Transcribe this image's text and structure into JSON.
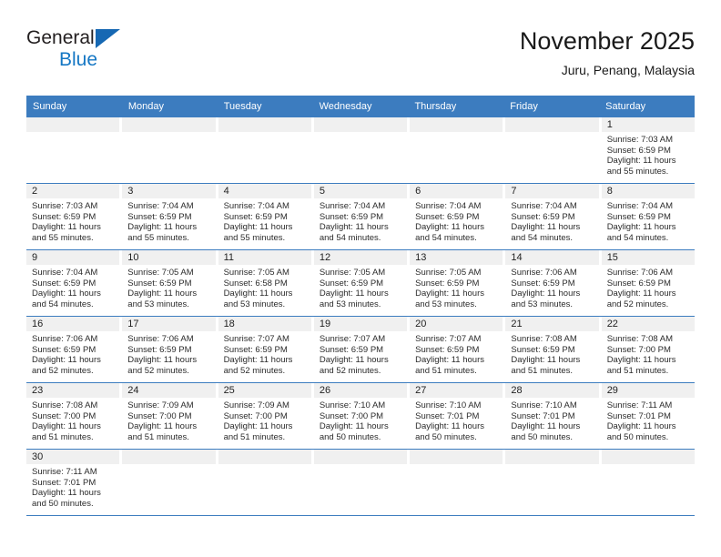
{
  "brand": {
    "name_top": "General",
    "name_bottom": "Blue",
    "flag_icon": "triangle-flag-icon",
    "color_black": "#231f20",
    "color_blue": "#1577c4"
  },
  "header": {
    "title": "November 2025",
    "subtitle": "Juru, Penang, Malaysia"
  },
  "theme": {
    "header_bar": "#3c7cbf",
    "day_band": "#f0f0f0",
    "row_divider": "#3c7cbf",
    "text": "#222222"
  },
  "calendar": {
    "weekdays": [
      "Sunday",
      "Monday",
      "Tuesday",
      "Wednesday",
      "Thursday",
      "Friday",
      "Saturday"
    ],
    "labels": {
      "sunrise": "Sunrise:",
      "sunset": "Sunset:",
      "daylight": "Daylight:"
    },
    "weeks": [
      [
        {
          "day": "",
          "lines": []
        },
        {
          "day": "",
          "lines": []
        },
        {
          "day": "",
          "lines": []
        },
        {
          "day": "",
          "lines": []
        },
        {
          "day": "",
          "lines": []
        },
        {
          "day": "",
          "lines": []
        },
        {
          "day": "1",
          "lines": [
            "Sunrise: 7:03 AM",
            "Sunset: 6:59 PM",
            "Daylight: 11 hours",
            "and 55 minutes."
          ]
        }
      ],
      [
        {
          "day": "2",
          "lines": [
            "Sunrise: 7:03 AM",
            "Sunset: 6:59 PM",
            "Daylight: 11 hours",
            "and 55 minutes."
          ]
        },
        {
          "day": "3",
          "lines": [
            "Sunrise: 7:04 AM",
            "Sunset: 6:59 PM",
            "Daylight: 11 hours",
            "and 55 minutes."
          ]
        },
        {
          "day": "4",
          "lines": [
            "Sunrise: 7:04 AM",
            "Sunset: 6:59 PM",
            "Daylight: 11 hours",
            "and 55 minutes."
          ]
        },
        {
          "day": "5",
          "lines": [
            "Sunrise: 7:04 AM",
            "Sunset: 6:59 PM",
            "Daylight: 11 hours",
            "and 54 minutes."
          ]
        },
        {
          "day": "6",
          "lines": [
            "Sunrise: 7:04 AM",
            "Sunset: 6:59 PM",
            "Daylight: 11 hours",
            "and 54 minutes."
          ]
        },
        {
          "day": "7",
          "lines": [
            "Sunrise: 7:04 AM",
            "Sunset: 6:59 PM",
            "Daylight: 11 hours",
            "and 54 minutes."
          ]
        },
        {
          "day": "8",
          "lines": [
            "Sunrise: 7:04 AM",
            "Sunset: 6:59 PM",
            "Daylight: 11 hours",
            "and 54 minutes."
          ]
        }
      ],
      [
        {
          "day": "9",
          "lines": [
            "Sunrise: 7:04 AM",
            "Sunset: 6:59 PM",
            "Daylight: 11 hours",
            "and 54 minutes."
          ]
        },
        {
          "day": "10",
          "lines": [
            "Sunrise: 7:05 AM",
            "Sunset: 6:59 PM",
            "Daylight: 11 hours",
            "and 53 minutes."
          ]
        },
        {
          "day": "11",
          "lines": [
            "Sunrise: 7:05 AM",
            "Sunset: 6:58 PM",
            "Daylight: 11 hours",
            "and 53 minutes."
          ]
        },
        {
          "day": "12",
          "lines": [
            "Sunrise: 7:05 AM",
            "Sunset: 6:59 PM",
            "Daylight: 11 hours",
            "and 53 minutes."
          ]
        },
        {
          "day": "13",
          "lines": [
            "Sunrise: 7:05 AM",
            "Sunset: 6:59 PM",
            "Daylight: 11 hours",
            "and 53 minutes."
          ]
        },
        {
          "day": "14",
          "lines": [
            "Sunrise: 7:06 AM",
            "Sunset: 6:59 PM",
            "Daylight: 11 hours",
            "and 53 minutes."
          ]
        },
        {
          "day": "15",
          "lines": [
            "Sunrise: 7:06 AM",
            "Sunset: 6:59 PM",
            "Daylight: 11 hours",
            "and 52 minutes."
          ]
        }
      ],
      [
        {
          "day": "16",
          "lines": [
            "Sunrise: 7:06 AM",
            "Sunset: 6:59 PM",
            "Daylight: 11 hours",
            "and 52 minutes."
          ]
        },
        {
          "day": "17",
          "lines": [
            "Sunrise: 7:06 AM",
            "Sunset: 6:59 PM",
            "Daylight: 11 hours",
            "and 52 minutes."
          ]
        },
        {
          "day": "18",
          "lines": [
            "Sunrise: 7:07 AM",
            "Sunset: 6:59 PM",
            "Daylight: 11 hours",
            "and 52 minutes."
          ]
        },
        {
          "day": "19",
          "lines": [
            "Sunrise: 7:07 AM",
            "Sunset: 6:59 PM",
            "Daylight: 11 hours",
            "and 52 minutes."
          ]
        },
        {
          "day": "20",
          "lines": [
            "Sunrise: 7:07 AM",
            "Sunset: 6:59 PM",
            "Daylight: 11 hours",
            "and 51 minutes."
          ]
        },
        {
          "day": "21",
          "lines": [
            "Sunrise: 7:08 AM",
            "Sunset: 6:59 PM",
            "Daylight: 11 hours",
            "and 51 minutes."
          ]
        },
        {
          "day": "22",
          "lines": [
            "Sunrise: 7:08 AM",
            "Sunset: 7:00 PM",
            "Daylight: 11 hours",
            "and 51 minutes."
          ]
        }
      ],
      [
        {
          "day": "23",
          "lines": [
            "Sunrise: 7:08 AM",
            "Sunset: 7:00 PM",
            "Daylight: 11 hours",
            "and 51 minutes."
          ]
        },
        {
          "day": "24",
          "lines": [
            "Sunrise: 7:09 AM",
            "Sunset: 7:00 PM",
            "Daylight: 11 hours",
            "and 51 minutes."
          ]
        },
        {
          "day": "25",
          "lines": [
            "Sunrise: 7:09 AM",
            "Sunset: 7:00 PM",
            "Daylight: 11 hours",
            "and 51 minutes."
          ]
        },
        {
          "day": "26",
          "lines": [
            "Sunrise: 7:10 AM",
            "Sunset: 7:00 PM",
            "Daylight: 11 hours",
            "and 50 minutes."
          ]
        },
        {
          "day": "27",
          "lines": [
            "Sunrise: 7:10 AM",
            "Sunset: 7:01 PM",
            "Daylight: 11 hours",
            "and 50 minutes."
          ]
        },
        {
          "day": "28",
          "lines": [
            "Sunrise: 7:10 AM",
            "Sunset: 7:01 PM",
            "Daylight: 11 hours",
            "and 50 minutes."
          ]
        },
        {
          "day": "29",
          "lines": [
            "Sunrise: 7:11 AM",
            "Sunset: 7:01 PM",
            "Daylight: 11 hours",
            "and 50 minutes."
          ]
        }
      ],
      [
        {
          "day": "30",
          "lines": [
            "Sunrise: 7:11 AM",
            "Sunset: 7:01 PM",
            "Daylight: 11 hours",
            "and 50 minutes."
          ]
        },
        {
          "day": "",
          "lines": []
        },
        {
          "day": "",
          "lines": []
        },
        {
          "day": "",
          "lines": []
        },
        {
          "day": "",
          "lines": []
        },
        {
          "day": "",
          "lines": []
        },
        {
          "day": "",
          "lines": []
        }
      ]
    ]
  }
}
